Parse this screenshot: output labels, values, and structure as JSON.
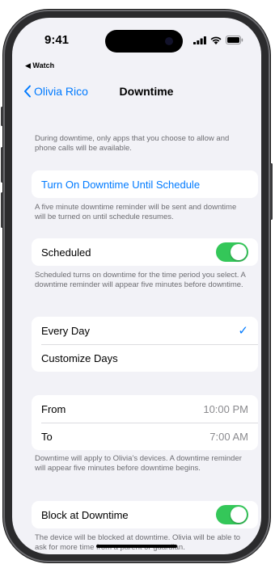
{
  "status_bar": {
    "time": "9:41"
  },
  "back_app": "◀ Watch",
  "nav": {
    "back_label": "Olivia Rico",
    "title": "Downtime"
  },
  "intro_text": "During downtime, only apps that you choose to allow and phone calls will be available.",
  "turn_on": {
    "label": "Turn On Downtime Until Schedule",
    "footnote": "A five minute downtime reminder will be sent and downtime will be turned on until schedule resumes."
  },
  "scheduled": {
    "label": "Scheduled",
    "enabled": true,
    "footnote": "Scheduled turns on downtime for the time period you select. A downtime reminder will appear five minutes before downtime."
  },
  "days": {
    "items": [
      {
        "label": "Every Day",
        "selected": true
      },
      {
        "label": "Customize Days",
        "selected": false
      }
    ]
  },
  "times": {
    "from_label": "From",
    "from_value": "10:00 PM",
    "to_label": "To",
    "to_value": "7:00 AM",
    "footnote": "Downtime will apply to Olivia’s devices. A downtime reminder will appear five minutes before downtime begins."
  },
  "block": {
    "label": "Block at Downtime",
    "enabled": true,
    "footnote": "The device will be blocked at downtime. Olivia will be able to ask for more time from a parent or guardian."
  },
  "colors": {
    "accent": "#007aff",
    "toggle_on": "#34c759",
    "background": "#f2f2f7"
  }
}
